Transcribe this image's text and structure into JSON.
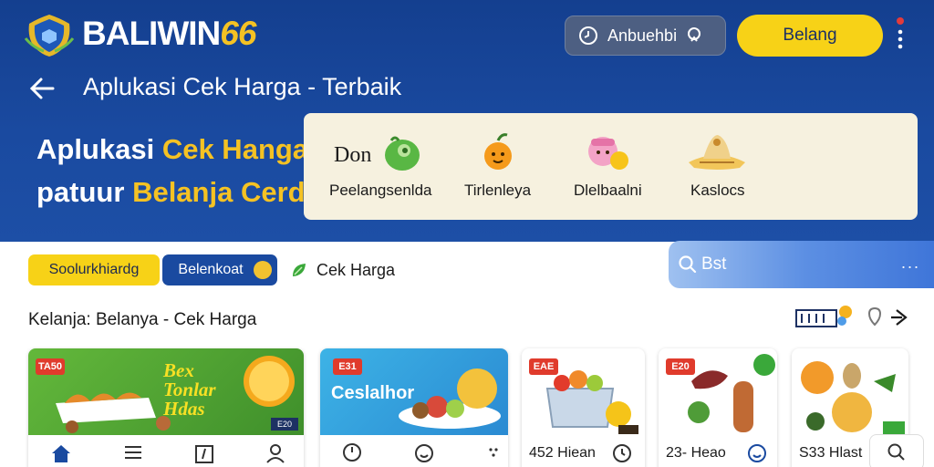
{
  "header": {
    "brand_main": "BALIWIN",
    "brand_accent": "66",
    "search_label": "Anbuehbi",
    "primary_button": "Belang",
    "subtitle": "Aplukasi Cek Harga - Terbaik"
  },
  "hero": {
    "line1_plain": "Aplukasi ",
    "line1_highlight": "Cek Hanga!",
    "line2_plain": "patuur ",
    "line2_highlight": "Belanja Cerdas"
  },
  "categories": {
    "lead": "Don",
    "items": [
      {
        "label": "Peelangsenlda",
        "icon": "green-bag-icon"
      },
      {
        "label": "Tirlenleya",
        "icon": "orange-fruit-icon"
      },
      {
        "label": "Dlelbaalni",
        "icon": "pink-character-icon"
      },
      {
        "label": "Kaslocs",
        "icon": "food-plate-icon"
      }
    ]
  },
  "filters": {
    "chip1": "Soolurkhiardg",
    "chip2": "Belenkoat",
    "chip3": "Cek Harga",
    "search_placeholder": "Bst",
    "search_more": "..."
  },
  "section": {
    "title": "Kelanja: Belanya - Cek Harga"
  },
  "products": [
    {
      "tag": "TA50",
      "banner": "Bex Tonlar Hdas",
      "small_badge": "E20"
    },
    {
      "tag": "E31",
      "banner": "Ceslalhor"
    },
    {
      "tag": "EAE",
      "price": "452 Hiean"
    },
    {
      "tag": "E20",
      "price": "23- Heao"
    },
    {
      "tag": "",
      "price": "S33 Hlast"
    }
  ],
  "colors": {
    "header_bg": "#1a4aa0",
    "accent_yellow": "#f7d217",
    "brand_gold": "#f5c223",
    "tag_red": "#e03b2c"
  }
}
